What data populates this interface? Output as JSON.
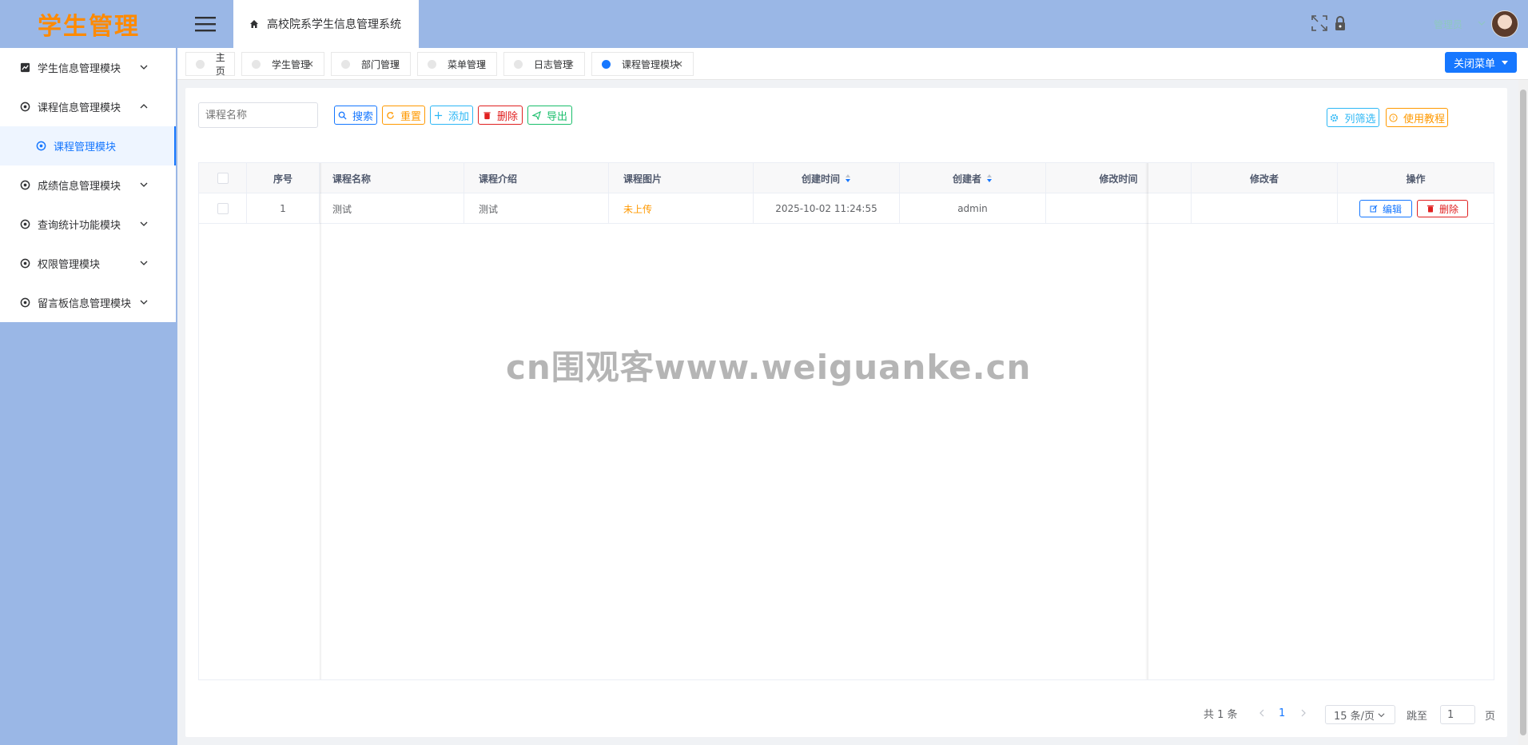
{
  "app": {
    "logo": "学生管理",
    "system_title": "高校院系学生信息管理系统",
    "user_name": "管理员"
  },
  "sidebar": {
    "items": [
      {
        "label": "学生信息管理模块",
        "icon": "chart-icon",
        "expanded": false
      },
      {
        "label": "课程信息管理模块",
        "icon": "gear-icon",
        "expanded": true
      },
      {
        "label": "课程管理模块",
        "icon": "gear-icon",
        "sub": true,
        "active": true
      },
      {
        "label": "成绩信息管理模块",
        "icon": "gear-icon",
        "expanded": false
      },
      {
        "label": "查询统计功能模块",
        "icon": "gear-icon",
        "expanded": false
      },
      {
        "label": "权限管理模块",
        "icon": "gear-icon",
        "expanded": false
      },
      {
        "label": "留言板信息管理模块",
        "icon": "gear-icon",
        "expanded": false
      }
    ]
  },
  "tabs": [
    {
      "label": "主页",
      "closable": false,
      "active": false
    },
    {
      "label": "学生管理",
      "closable": true,
      "active": false
    },
    {
      "label": "部门管理",
      "closable": true,
      "active": false
    },
    {
      "label": "菜单管理",
      "closable": true,
      "active": false
    },
    {
      "label": "日志管理",
      "closable": true,
      "active": false
    },
    {
      "label": "课程管理模块",
      "closable": true,
      "active": true
    }
  ],
  "close_menu_label": "关闭菜单",
  "toolbar": {
    "search_placeholder": "课程名称",
    "search_label": "搜索",
    "reset_label": "重置",
    "add_label": "添加",
    "delete_label": "删除",
    "export_label": "导出",
    "column_filter_label": "列筛选",
    "tutorial_label": "使用教程"
  },
  "table": {
    "headers": [
      "序号",
      "课程名称",
      "课程介绍",
      "课程图片",
      "创建时间",
      "创建者",
      "修改时间",
      "修改者",
      "操作"
    ],
    "rows": [
      {
        "index": "1",
        "name": "测试",
        "intro": "测试",
        "image": "未上传",
        "created_at": "2025-10-02 11:24:55",
        "creator": "admin",
        "modified_at": "",
        "modifier": ""
      }
    ],
    "edit_label": "编辑",
    "delete_label": "删除"
  },
  "pagination": {
    "total_text": "共 1 条",
    "current_page": "1",
    "page_size": "15 条/页",
    "goto_label": "跳至",
    "goto_value": "1",
    "page_unit": "页"
  },
  "watermark": "cn围观客www.weiguanke.cn",
  "colors": {
    "primary": "#1677ff",
    "orange": "#ff9900",
    "red": "#e02020",
    "green": "#19be6b",
    "cyan": "#2db7f5",
    "sidebar_bg": "#9ab7e6"
  }
}
